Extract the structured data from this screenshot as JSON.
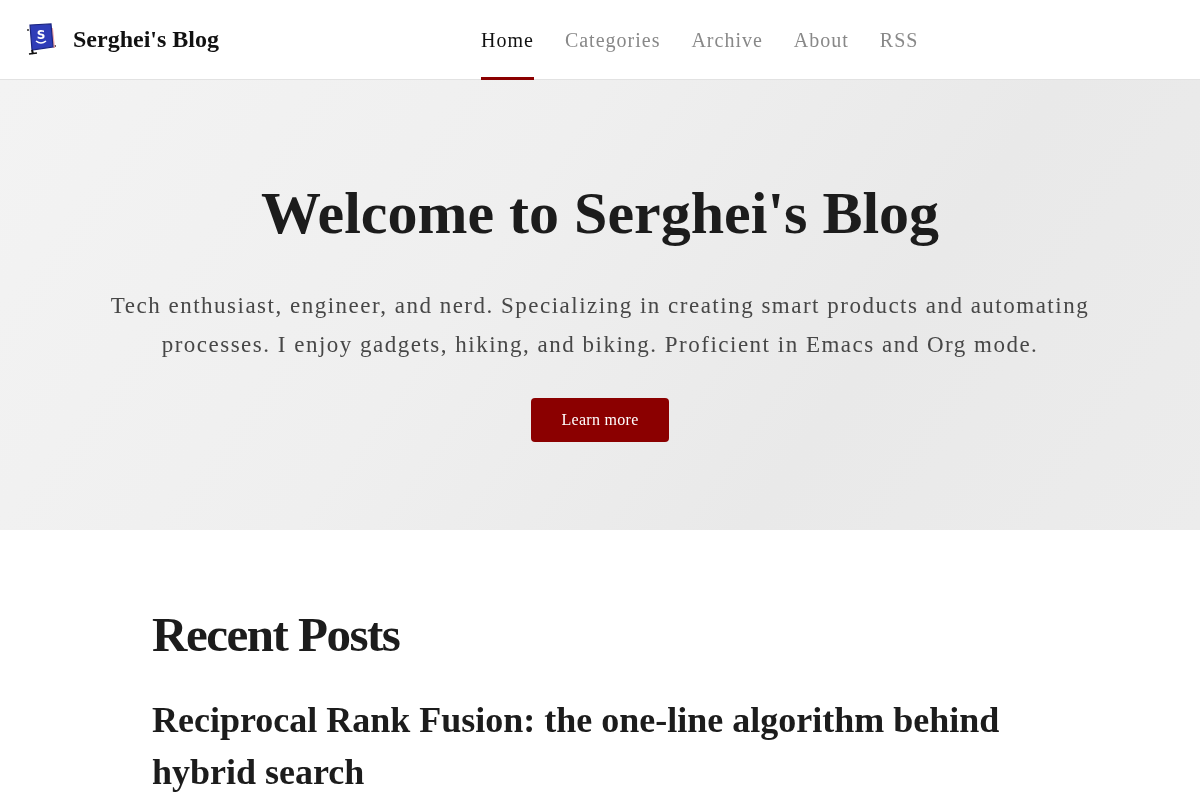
{
  "header": {
    "logo_letter": "S",
    "site_title": "Serghei's Blog",
    "nav": [
      {
        "label": "Home",
        "selected": true
      },
      {
        "label": "Categories",
        "selected": false
      },
      {
        "label": "Archive",
        "selected": false
      },
      {
        "label": "About",
        "selected": false
      },
      {
        "label": "RSS",
        "selected": false
      }
    ]
  },
  "hero": {
    "title": "Welcome to Serghei's Blog",
    "description": "Tech enthusiast, engineer, and nerd. Specializing in creating smart products and automating processes. I enjoy gadgets, hiking, and biking. Proficient in Emacs and Org mode.",
    "button": "Learn more"
  },
  "recent_posts": {
    "heading": "Recent Posts",
    "posts": [
      {
        "title": "Reciprocal Rank Fusion: the one-line algorithm behind hybrid search"
      }
    ]
  }
}
